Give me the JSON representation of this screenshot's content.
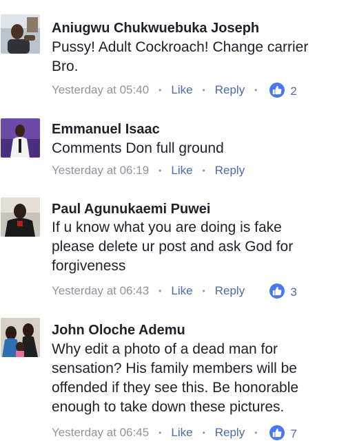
{
  "comments": [
    {
      "author": "Aniugwu Chukwuebuka Joseph",
      "text": "Pussy! Adult Cockroach! Change carrier Bro.",
      "time": "Yesterday at 05:40",
      "like_label": "Like",
      "reply_label": "Reply",
      "reactions": "2"
    },
    {
      "author": "Emmanuel Isaac",
      "text": "Comments Don full ground",
      "time": "Yesterday at 06:19",
      "like_label": "Like",
      "reply_label": "Reply"
    },
    {
      "author": "Paul Agunukaemi Puwei",
      "text": "If u know what you are doing is fake please delete ur post and ask God for forgiveness",
      "time": "Yesterday at 06:43",
      "like_label": "Like",
      "reply_label": "Reply",
      "reactions": "3"
    },
    {
      "author": "John Oloche Ademu",
      "text": "Why edit a photo of a dead man for sensation? His family members will be offended if they see this. Be honorable enough to take down these pictures.",
      "time": "Yesterday at 06:45",
      "like_label": "Like",
      "reply_label": "Reply",
      "reactions": "7"
    }
  ],
  "icons": {
    "reaction": "thumbs-up-icon",
    "separator": "•"
  },
  "colors": {
    "author": "#1d2129",
    "meta": "#90949c",
    "link": "#4b6aa8",
    "like_badge": "#4a78f2"
  }
}
